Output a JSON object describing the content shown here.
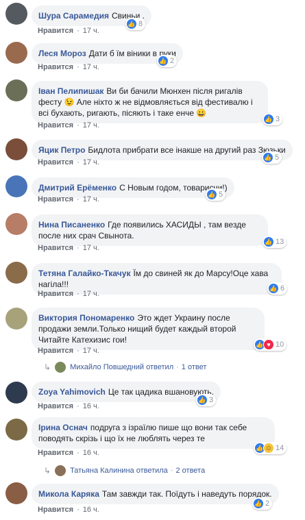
{
  "like_label": "Нравится",
  "comments": [
    {
      "author": "Шура Сарамедия",
      "text": "Свиньи .",
      "time": "17 ч.",
      "count": "8",
      "avatar_color": "#555a60"
    },
    {
      "author": "Леся Мороз",
      "text": "Дати б їм віники в руки",
      "time": "17 ч.",
      "count": "2",
      "avatar_color": "#9a6a4e"
    },
    {
      "author": "Іван Пелипишак",
      "text": "Ви би бачили Мюнхен після ригалів фесту 😉 Але ніхто ж не відмовляється від фестивалю і всі бухають, ригають, пісяють і таке енче 😀",
      "time": "17 ч.",
      "count": "3",
      "avatar_color": "#6c6f57"
    },
    {
      "author": "Яцик Петро",
      "text": "Бидлота прибрати все інакше на другий раз Зюзьки",
      "time": "17 ч.",
      "count": "5",
      "avatar_color": "#7a4e3b"
    },
    {
      "author": "Дмитрий Ерёменко",
      "text": "С Новым годом, товарисчи!)",
      "time": "17 ч.",
      "count": "5",
      "avatar_color": "#4a74b8"
    },
    {
      "author": "Нина Писаненко",
      "text": "Где появились ХАСИДЫ , там везде после них срач Свынота.",
      "time": "17 ч.",
      "count": "13",
      "avatar_color": "#b77d66"
    },
    {
      "author": "Тетяна Галайко-Ткачук",
      "text": "Їм до свиней як до Марсу!Оце хава нагіла!!!",
      "time": "17 ч.",
      "count": "6",
      "avatar_color": "#8a6b4a"
    },
    {
      "author": "Виктория Пономаренко",
      "text": "Это ждет Украину после продажи земли.Только нищий будет каждый второй Читайте Катехизис гои!",
      "time": "17 ч.",
      "count": "10",
      "avatar_color": "#a8a27a",
      "reply_name": "Михайло Повшедний ответил",
      "reply_count": "1 ответ"
    },
    {
      "author": "Zoya Yahimovich",
      "text": "Це так цадика вшановують.",
      "time": "16 ч.",
      "count": "3",
      "avatar_color": "#2e3b4e"
    },
    {
      "author": "Ірина Оснач",
      "text": "подруга з ізраїлю пише що вони так себе поводять скрізь і що їх не люблять через те",
      "time": "16 ч.",
      "count": "14",
      "avatar_color": "#7b6a45",
      "reply_name": "Татьяна Калинина ответила",
      "reply_count": "2 ответа"
    },
    {
      "author": "Микола Каряка",
      "text": "Там завжди так. Поїдуть і наведуть порядок.",
      "time": "16 ч.",
      "count": "2",
      "avatar_color": "#8a5d45"
    }
  ]
}
